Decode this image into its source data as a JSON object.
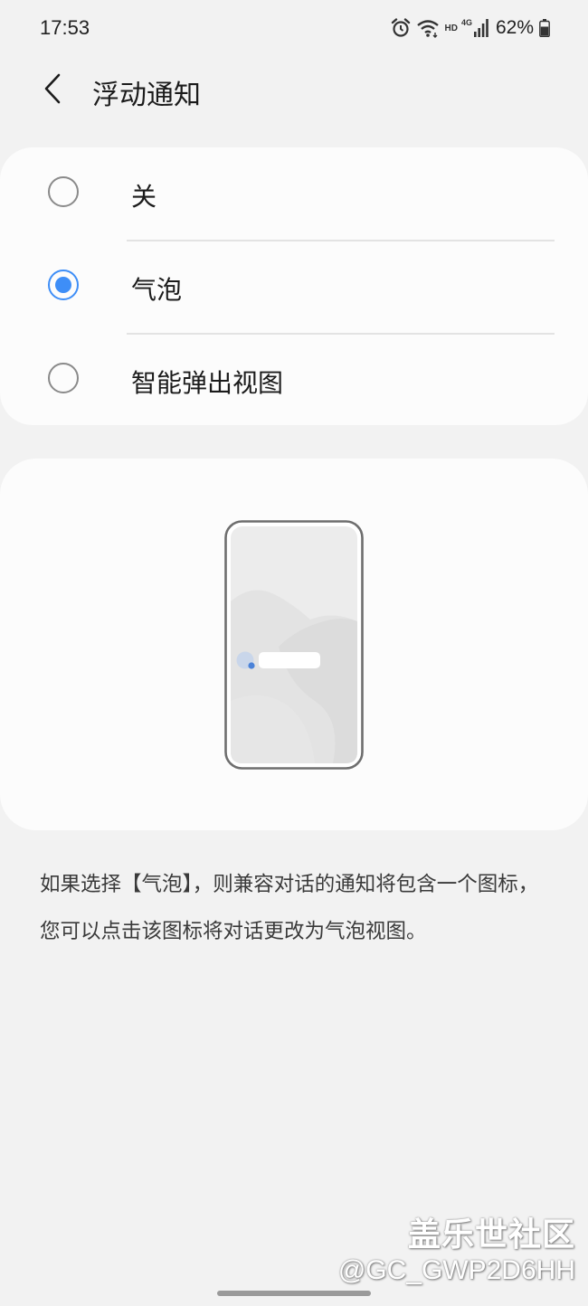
{
  "status_bar": {
    "time": "17:53",
    "hd_label": "HD",
    "network_label": "4G",
    "battery": "62%",
    "icons": [
      "alarm-icon",
      "wifi-icon",
      "signal-icon",
      "battery-icon"
    ]
  },
  "header": {
    "back_icon": "chevron-left-icon",
    "title": "浮动通知"
  },
  "options": {
    "items": [
      {
        "label": "关",
        "selected": false
      },
      {
        "label": "气泡",
        "selected": true
      },
      {
        "label": "智能弹出视图",
        "selected": false
      }
    ]
  },
  "preview": {
    "illustration": "phone-bubble-illustration"
  },
  "description": "如果选择【气泡】，则兼容对话的通知将包含一个图标，您可以点击该图标将对话更改为气泡视图。",
  "watermark": {
    "site": "盖乐世社区",
    "user": "@GC_GWP2D6HH"
  },
  "colors": {
    "accent": "#3e8ef7",
    "background": "#f2f2f2",
    "card": "#fcfcfc"
  }
}
